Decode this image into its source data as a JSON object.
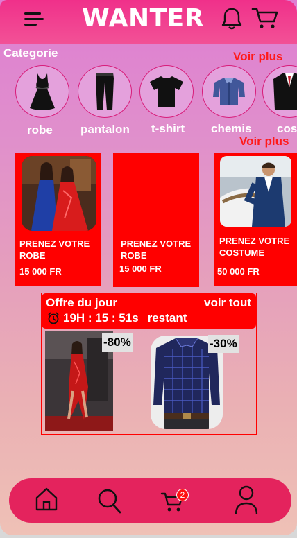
{
  "header": {
    "brand": "WANTER"
  },
  "categories": {
    "title": "Categorie",
    "see_more": "Voir plus",
    "items": [
      {
        "label": "robe",
        "icon": "dress-icon"
      },
      {
        "label": "pantalon",
        "icon": "trousers-icon"
      },
      {
        "label": "t-shirt",
        "icon": "tshirt-icon"
      },
      {
        "label": "chemis",
        "icon": "shirt-icon"
      },
      {
        "label": "cos",
        "icon": "suit-icon"
      }
    ]
  },
  "products": {
    "see_more": "Voir plus",
    "items": [
      {
        "title": "PRENEZ VOTRE ROBE",
        "price": "15 000 FR"
      },
      {
        "title": "PRENEZ VOTRE ROBE",
        "price": "15 000 FR"
      },
      {
        "title": "PRENEZ VOTRE COSTUME",
        "price": "50 000 FR"
      }
    ]
  },
  "offer": {
    "title": "Offre du jour",
    "see_all": "voir tout",
    "timer": "19H : 15 : 51s",
    "timer_suffix": "restant",
    "items": [
      {
        "discount": "-80%"
      },
      {
        "discount": "-30%"
      }
    ]
  },
  "nav": {
    "items": [
      "home-icon",
      "search-icon",
      "cart-icon",
      "profile-icon"
    ],
    "cart_count": "2"
  },
  "colors": {
    "accent_red": "#ff0000",
    "header_pink": "#f0308a",
    "nav_pink": "#e4235d"
  }
}
